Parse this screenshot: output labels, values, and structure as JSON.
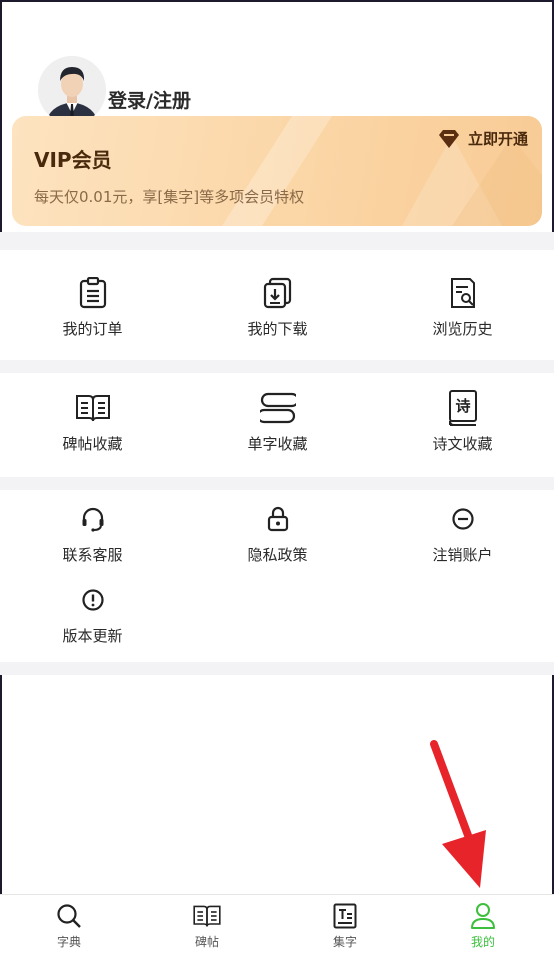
{
  "profile": {
    "login_label": "登录/注册"
  },
  "vip": {
    "title": "VIP会员",
    "description": "每天仅0.01元，享[集字]等多项会员特权",
    "open_label": "立即开通"
  },
  "menu_section_1": [
    {
      "label": "我的订单",
      "icon": "clipboard-icon"
    },
    {
      "label": "我的下载",
      "icon": "download-icon"
    },
    {
      "label": "浏览历史",
      "icon": "history-icon"
    }
  ],
  "menu_section_2": [
    {
      "label": "碑帖收藏",
      "icon": "open-book-icon"
    },
    {
      "label": "单字收藏",
      "icon": "stack-icon"
    },
    {
      "label": "诗文收藏",
      "icon": "poem-book-icon",
      "glyph": "诗"
    }
  ],
  "menu_section_3": [
    {
      "label": "联系客服",
      "icon": "headset-icon"
    },
    {
      "label": "隐私政策",
      "icon": "lock-icon"
    },
    {
      "label": "注销账户",
      "icon": "minus-circle-icon"
    },
    {
      "label": "版本更新",
      "icon": "info-circle-icon"
    }
  ],
  "tabbar": [
    {
      "label": "字典",
      "icon": "search-icon"
    },
    {
      "label": "碑帖",
      "icon": "open-book-icon"
    },
    {
      "label": "集字",
      "icon": "text-icon"
    },
    {
      "label": "我的",
      "icon": "user-icon",
      "active": true
    }
  ],
  "colors": {
    "accent": "#3cbf3c",
    "vip_text": "#4a2a0c",
    "annotation_arrow": "#e8242b"
  }
}
